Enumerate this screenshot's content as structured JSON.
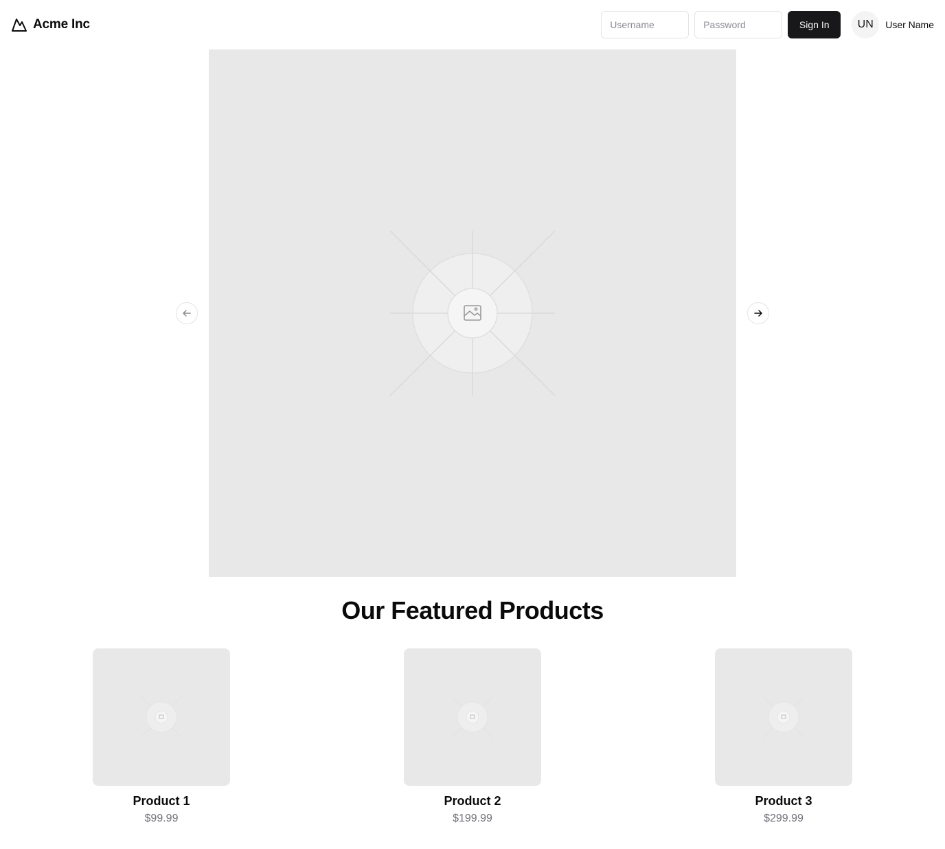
{
  "header": {
    "brand_name": "Acme Inc",
    "brand_icon": "mountain-icon",
    "login": {
      "username_placeholder": "Username",
      "username_value": "",
      "password_placeholder": "Password",
      "password_value": "",
      "signin_label": "Sign In"
    },
    "user": {
      "initials": "UN",
      "name": "User Name"
    }
  },
  "carousel": {
    "image_icon": "image-placeholder-icon",
    "prev_icon": "arrow-left-icon",
    "next_icon": "arrow-right-icon"
  },
  "featured": {
    "title": "Our Featured Products",
    "products": [
      {
        "name": "Product 1",
        "price": "$99.99"
      },
      {
        "name": "Product 2",
        "price": "$199.99"
      },
      {
        "name": "Product 3",
        "price": "$299.99"
      }
    ]
  },
  "colors": {
    "primary_button": "#18181b",
    "placeholder_bg": "#e8e8e8",
    "muted_text": "#71717a"
  }
}
